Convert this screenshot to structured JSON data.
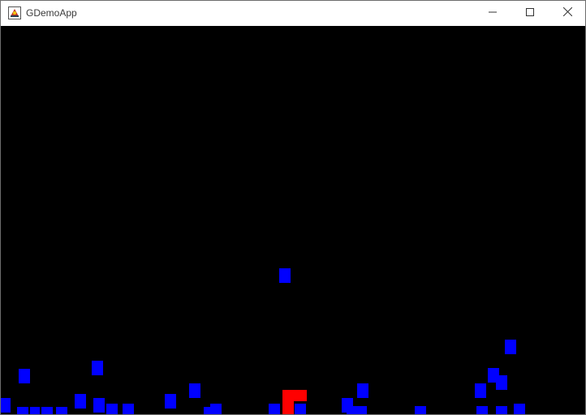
{
  "window": {
    "title": "GDemoApp",
    "icon": "java-app-icon",
    "controls": {
      "minimize_icon": "minimize-icon",
      "maximize_icon": "maximize-icon",
      "close_icon": "close-icon"
    }
  },
  "game": {
    "background_color": "#000000",
    "enemy_color": "#0000ff",
    "player_color": "#ff0000"
  }
}
